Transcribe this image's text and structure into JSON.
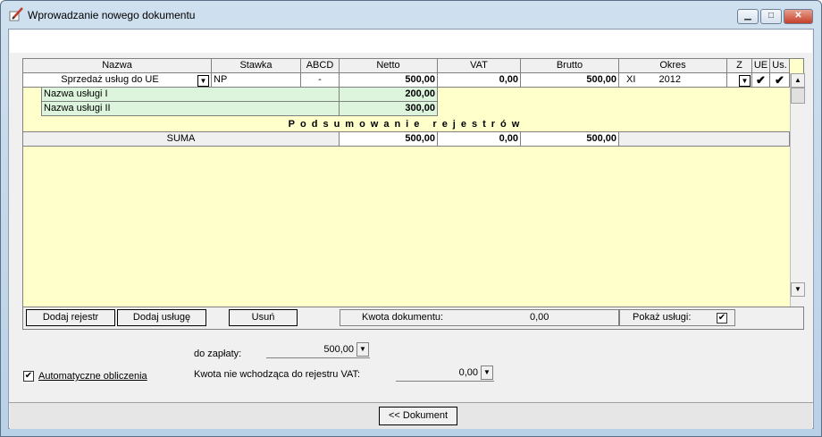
{
  "window": {
    "title": "Wprowadzanie nowego dokumentu",
    "icon": "pen-document-icon",
    "controls": {
      "minimize": "▁",
      "maximize": "□",
      "close": "✕"
    }
  },
  "grid": {
    "headers": [
      "Nazwa",
      "Stawka",
      "ABCD",
      "Netto",
      "VAT",
      "Brutto",
      "Okres",
      "Z",
      "UE",
      "Us."
    ],
    "register_row": {
      "name": "Sprzedaż usług do UE",
      "rate": "NP",
      "abcd": "-",
      "net": "500,00",
      "vat": "0,00",
      "gross": "500,00",
      "period_month": "XI",
      "period_year": "2012",
      "ue_check": "✔",
      "us_check": "✔"
    },
    "services": [
      {
        "name": "Nazwa usługi I",
        "net": "200,00"
      },
      {
        "name": "Nazwa usługi II",
        "net": "300,00"
      }
    ],
    "summary_title": "Podsumowanie rejestrów",
    "sum_row": {
      "label": "SUMA",
      "net": "500,00",
      "vat": "0,00",
      "gross": "500,00"
    }
  },
  "bottombar": {
    "add_register": "Dodaj rejestr",
    "add_service": "Dodaj usługę",
    "delete": "Usuń",
    "doc_amount_label": "Kwota dokumentu:",
    "doc_amount_value": "0,00",
    "show_services_label": "Pokaż usługi:",
    "show_services_checked": "✔"
  },
  "form": {
    "to_pay_label": "do zapłaty:",
    "to_pay_value": "500,00",
    "auto_calc_label": "Automatyczne obliczenia",
    "auto_calc_checked": "✔",
    "not_in_vat_label": "Kwota nie wchodząca do rejestru VAT:",
    "not_in_vat_value": "0,00"
  },
  "footer": {
    "back_button": "<< Dokument"
  }
}
